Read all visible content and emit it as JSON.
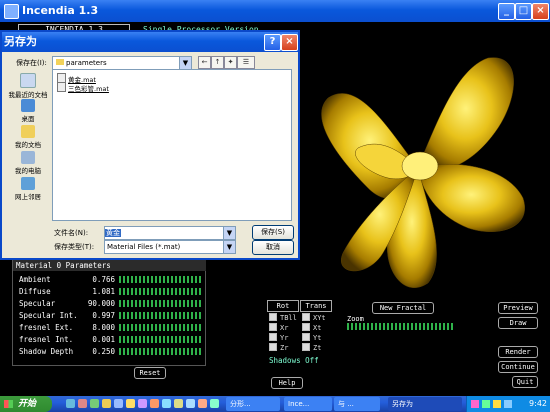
{
  "window": {
    "title": "Incendia 1.3"
  },
  "header": {
    "app_name": "INCENDIA 1.3",
    "mode": "Single Processor Version"
  },
  "dialog": {
    "title": "另存为",
    "save_in_label": "保存在(I):",
    "folder": "parameters",
    "places": [
      "我最近的文档",
      "桌面",
      "我的文档",
      "我的电脑",
      "网上邻居"
    ],
    "files": [
      "黄金.mat",
      "三色彩管.mat"
    ],
    "filename_label": "文件名(N):",
    "filename_value": "黄金",
    "filetype_label": "保存类型(T):",
    "filetype_value": "Material Files (*.mat)",
    "save_button": "保存(S)",
    "cancel_button": "取消"
  },
  "material": {
    "title": "Material 0  Parameters",
    "rows": [
      {
        "label": "Ambient",
        "value": "0.766"
      },
      {
        "label": "Diffuse",
        "value": "1.081"
      },
      {
        "label": "Specular",
        "value": "90.000"
      },
      {
        "label": "Specular Int.",
        "value": "0.997"
      },
      {
        "label": "fresnel Ext.",
        "value": "8.000"
      },
      {
        "label": "fresnel Int.",
        "value": "0.001"
      },
      {
        "label": "Shadow Depth",
        "value": "0.250"
      }
    ],
    "reset_button": "Reset"
  },
  "controls": {
    "rot_label": "Rot",
    "trans_label": "Trans",
    "rot_items": [
      "TBll",
      "Xr",
      "Yr",
      "Zr"
    ],
    "trans_items": [
      "XYt",
      "Xt",
      "Yt",
      "Zt"
    ],
    "new_fractal": "New Fractal",
    "zoom_label": "Zoom",
    "preview": "Preview",
    "draw": "Draw",
    "shadows": "Shadows Off",
    "help": "Help",
    "render": "Render",
    "continue": "Continue",
    "quit": "Quit"
  },
  "taskbar": {
    "start": "开始",
    "tasks": [
      "分形...",
      "Ince...",
      "与 ...",
      "另存为"
    ],
    "clock": "9:42"
  }
}
